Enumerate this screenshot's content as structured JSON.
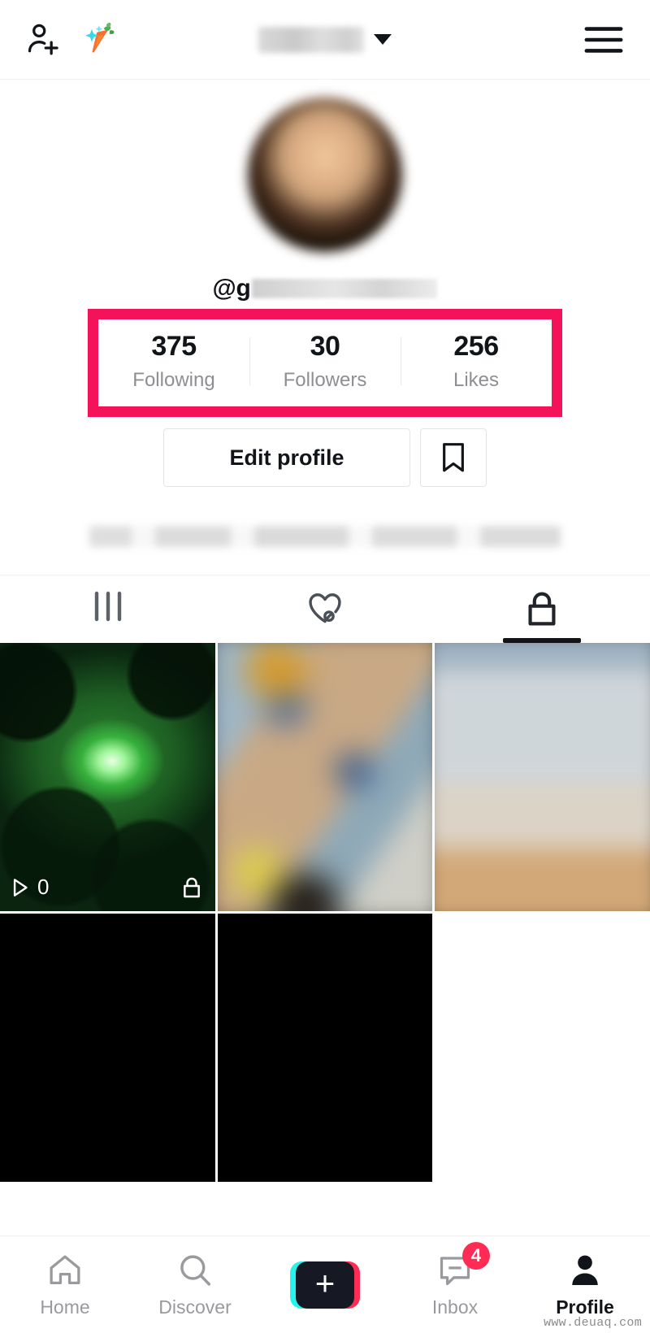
{
  "app": "TikTok",
  "header": {
    "add_person_icon": "add-person-icon",
    "carrot_icon": "carrot-sparkle-icon",
    "username_redacted": "",
    "caret_icon": "chevron-down-icon",
    "menu_icon": "hamburger-menu-icon"
  },
  "profile": {
    "avatar_alt": "profile-avatar",
    "handle_prefix": "@g",
    "handle_redacted": "",
    "bio_redacted": ""
  },
  "stats": {
    "highlight_color": "#F4135A",
    "items": [
      {
        "value": "375",
        "label": "Following"
      },
      {
        "value": "30",
        "label": "Followers"
      },
      {
        "value": "256",
        "label": "Likes"
      }
    ]
  },
  "actions": {
    "edit_profile_label": "Edit profile",
    "bookmark_icon": "bookmark-icon"
  },
  "content_tabs": [
    {
      "icon": "grid-icon",
      "name": "tab-videos",
      "active": false
    },
    {
      "icon": "heart-off-icon",
      "name": "tab-liked",
      "active": false
    },
    {
      "icon": "lock-icon",
      "name": "tab-private",
      "active": true
    }
  ],
  "videos": [
    {
      "kind": "green-forest",
      "plays": "0",
      "locked": true
    },
    {
      "kind": "blurred-photo-a",
      "plays": "",
      "locked": false
    },
    {
      "kind": "blurred-photo-b",
      "plays": "",
      "locked": false
    },
    {
      "kind": "black",
      "plays": "",
      "locked": false
    },
    {
      "kind": "black",
      "plays": "",
      "locked": false
    }
  ],
  "bottom_nav": [
    {
      "label": "Home",
      "icon": "home-icon",
      "active": false,
      "badge": ""
    },
    {
      "label": "Discover",
      "icon": "search-icon",
      "active": false,
      "badge": ""
    },
    {
      "label": "",
      "icon": "create-plus-icon",
      "active": false,
      "badge": ""
    },
    {
      "label": "Inbox",
      "icon": "inbox-icon",
      "active": false,
      "badge": "4"
    },
    {
      "label": "Profile",
      "icon": "person-icon",
      "active": true,
      "badge": ""
    }
  ],
  "watermark": "www.deuaq.com"
}
